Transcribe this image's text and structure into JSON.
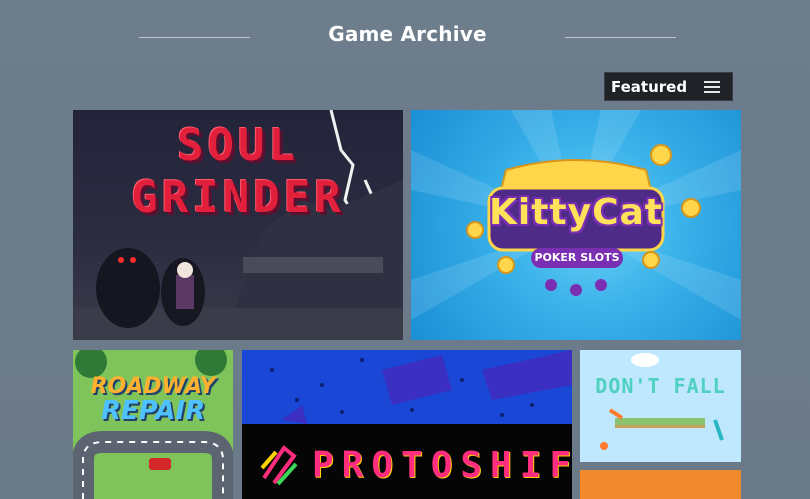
{
  "header": {
    "title": "Game Archive"
  },
  "filter": {
    "label": "Featured",
    "icon": "hamburger-menu-icon"
  },
  "games": [
    {
      "title_line1": "SOUL",
      "title_line2": "GRINDER"
    },
    {
      "title": "KittyCat",
      "subtitle": "POKER SLOTS"
    },
    {
      "title_line1": "ROADWAY",
      "title_line2": "REPAIR"
    },
    {
      "title": "PROTOSHIFT"
    },
    {
      "title": "DON'T FALL"
    },
    {
      "title": ""
    }
  ],
  "colors": {
    "background": "#6f7f8e",
    "dropdown_bg": "#1f2227",
    "text": "#ffffff"
  }
}
